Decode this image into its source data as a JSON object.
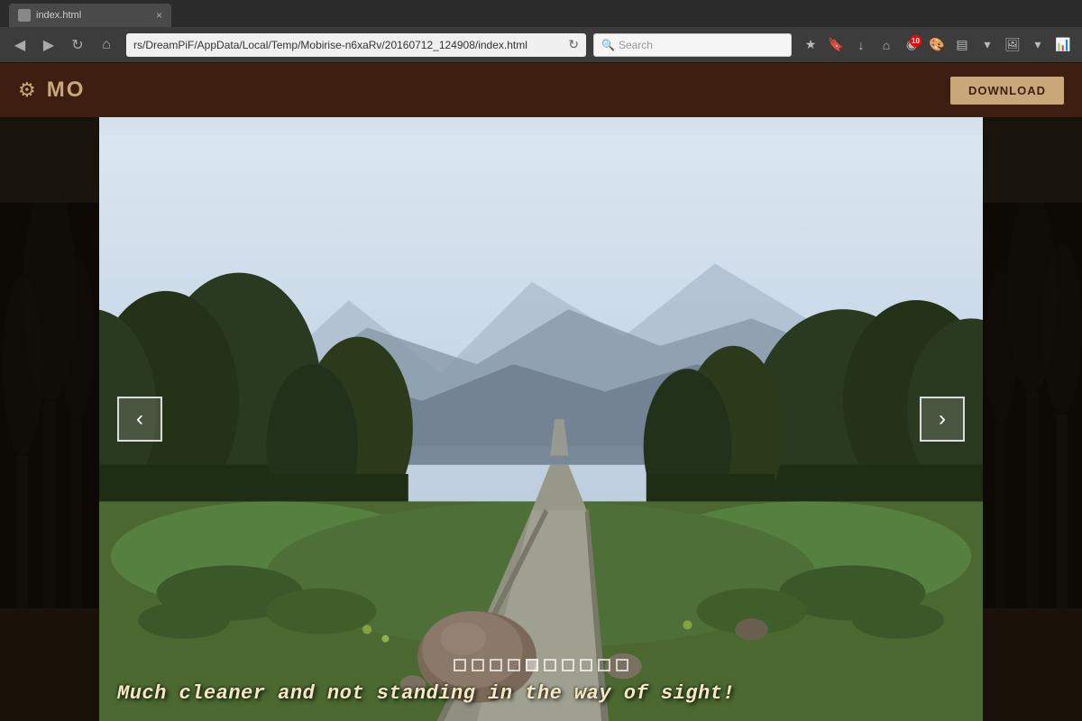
{
  "browser": {
    "address": "rs/DreamPiF/AppData/Local/Temp/Mobirise-n6xaRv/20160712_124908/index.html",
    "reload_title": "Reload page",
    "search_placeholder": "Search",
    "tab_label": "index.html",
    "nav": {
      "back": "‹",
      "forward": "›",
      "reload": "↺",
      "home": "⌂"
    },
    "toolbar_icons": [
      "★",
      "🔒",
      "↓",
      "⌂",
      "◉",
      "🎨",
      "▤",
      "↓",
      "🖼",
      "↓",
      "📊"
    ]
  },
  "app": {
    "logo": "MO",
    "download_label": "DOWNLOAD",
    "gear_icon": "⚙"
  },
  "slider": {
    "caption": "Much cleaner and not standing in the way of sight!",
    "prev_label": "‹",
    "next_label": "›",
    "dots": [
      {
        "active": false
      },
      {
        "active": false
      },
      {
        "active": false
      },
      {
        "active": false
      },
      {
        "active": true
      },
      {
        "active": false
      },
      {
        "active": false
      },
      {
        "active": false
      },
      {
        "active": false
      },
      {
        "active": false
      }
    ]
  },
  "colors": {
    "accent": "#c8a878",
    "header_bg": "#3d1e10",
    "dark_bg": "#2a1f1a",
    "caption_color": "#f5e8c0"
  }
}
